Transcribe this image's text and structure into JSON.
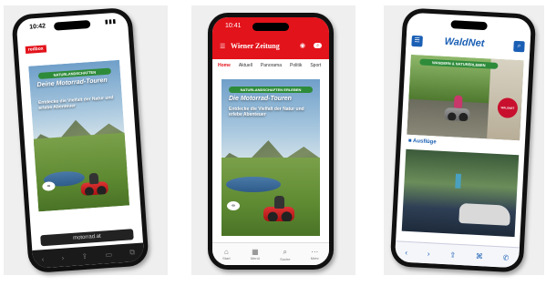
{
  "phone1": {
    "time": "10:42",
    "site_label": "redbox",
    "ad": {
      "pill": "NATURLANDSCHAFTEN",
      "headline": "Deine Motorrad-Touren",
      "subline": "Entdecke die Vielfalt der Natur und erlebe Abenteuer"
    },
    "url_bar": "motorrad.at",
    "accent": "#2e8b3a"
  },
  "phone2": {
    "time": "10:41",
    "brand": "Wiener Zeitung",
    "tabs": [
      "Home",
      "Aktuell",
      "Panorama",
      "Politik",
      "Sport"
    ],
    "ad": {
      "pill": "NATURLANDSCHAFTEN ERLEBEN",
      "headline": "Die Motorrad-Touren",
      "subline": "Entdecke die Vielfalt der Natur und erlebe Abenteuer"
    },
    "bottom_nav": [
      "Start",
      "Menü",
      "Suche",
      "Mehr"
    ],
    "accent": "#e3131b"
  },
  "phone3": {
    "brand": "WaldNet",
    "ad": {
      "pill": "WANDERN & NATURERLEBEN",
      "badge": "WALDNET"
    },
    "section_label": "Ausflüge",
    "accent": "#1a5fb4"
  }
}
